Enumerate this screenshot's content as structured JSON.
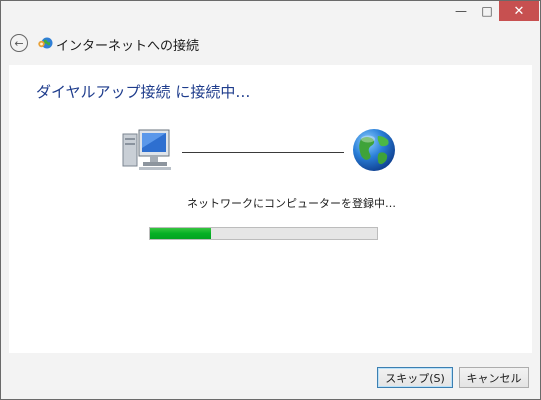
{
  "window": {
    "minimize_icon": "minimize-icon",
    "maximize_icon": "maximize-icon",
    "close_icon": "close-icon",
    "minimize_label": "—",
    "maximize_label": "□",
    "close_label": "✕"
  },
  "nav": {
    "back_icon": "back-arrow-icon",
    "back_label": "←",
    "app_icon": "internet-connection-icon",
    "title": "インターネットへの接続"
  },
  "main": {
    "heading": "ダイヤルアップ接続 に接続中…",
    "computer_icon": "computer-icon",
    "globe_icon": "globe-icon",
    "status_text": "ネットワークにコンピューターを登録中…",
    "progress": {
      "value": 0.27
    }
  },
  "footer": {
    "skip_label": "スキップ(S)",
    "cancel_label": "キャンセル"
  },
  "colors": {
    "heading": "#1e3c8c",
    "progress_fill": "#06b025",
    "close_button": "#c75050"
  }
}
